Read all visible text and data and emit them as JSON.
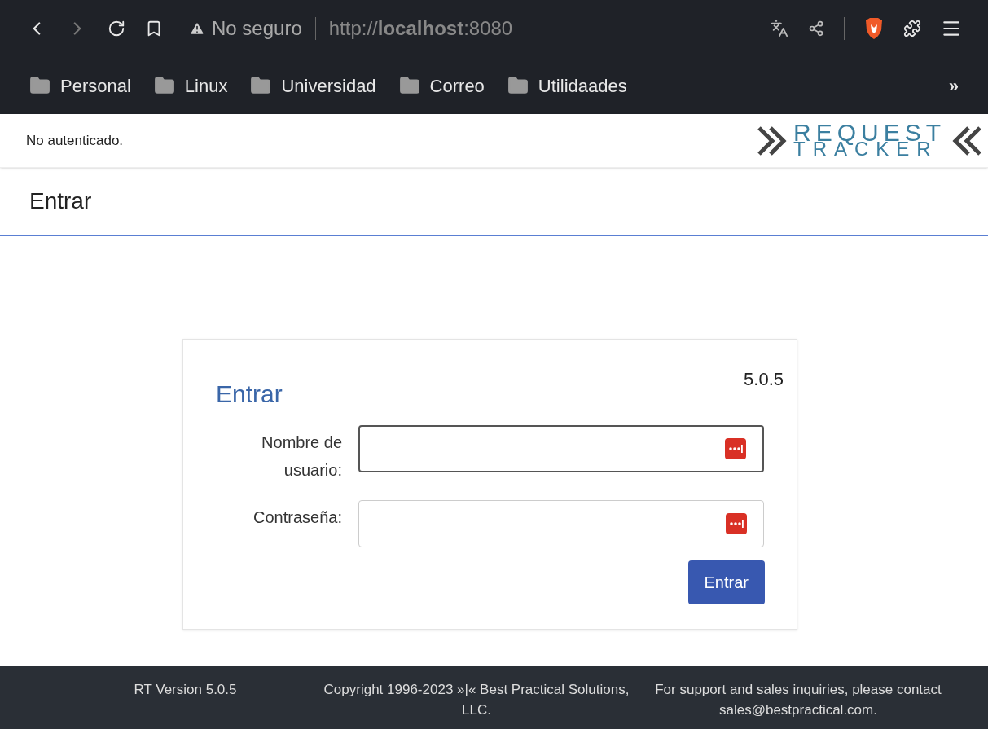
{
  "browser": {
    "security": "No seguro",
    "url": "http://**localhost**:8080",
    "bookmarks": [
      "Personal",
      "Linux",
      "Universidad",
      "Correo",
      "Utilidaades"
    ],
    "overflow": "»"
  },
  "header": {
    "auth_status": "No autenticado.",
    "logo": {
      "top": "REQUEST",
      "bottom": "TRACKER"
    }
  },
  "page_title": "Entrar",
  "login": {
    "title": "Entrar",
    "version": "5.0.5",
    "fields": [
      {
        "label": "Nombre de usuario:",
        "focused": true
      },
      {
        "label": "Contraseña:",
        "focused": false
      }
    ],
    "submit": "Entrar"
  },
  "footer": [
    "RT Version 5.0.5",
    "Copyright 1996-2023 »|« Best Practical Solutions, LLC.",
    "For support and sales inquiries, please contact sales@bestpractical.com."
  ]
}
